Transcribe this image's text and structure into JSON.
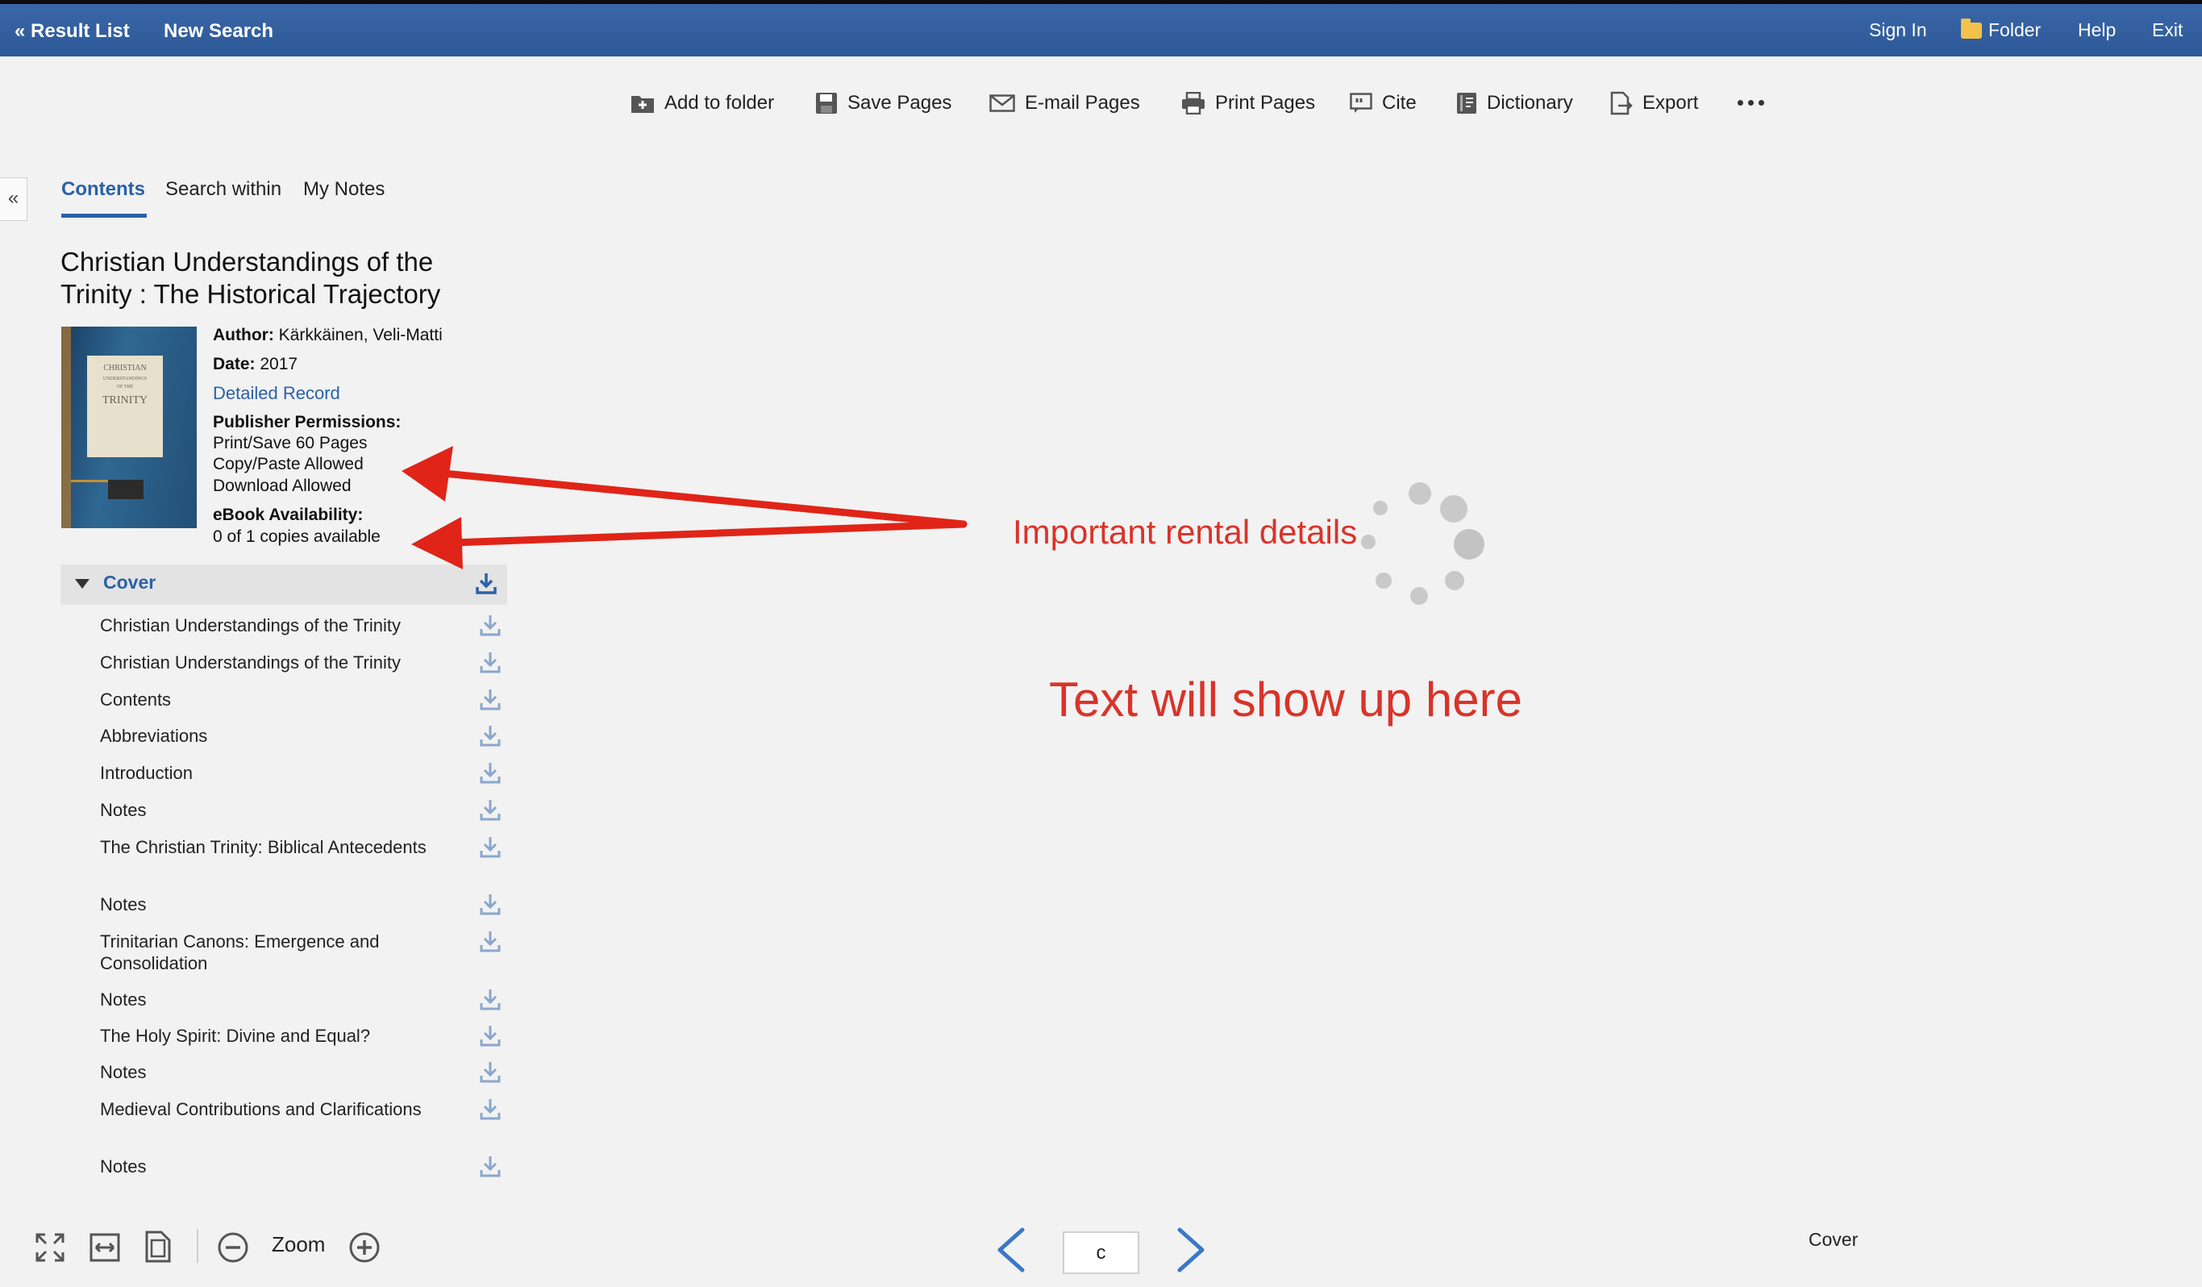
{
  "topbar": {
    "result_list": "« Result List",
    "new_search": "New Search",
    "sign_in": "Sign In",
    "folder": "Folder",
    "help": "Help",
    "exit": "Exit"
  },
  "toolbar": {
    "add_to_folder": "Add to folder",
    "save_pages": "Save Pages",
    "email_pages": "E-mail Pages",
    "print_pages": "Print Pages",
    "cite": "Cite",
    "dictionary": "Dictionary",
    "export": "Export"
  },
  "sidebar": {
    "collapse": "«",
    "tabs": [
      "Contents",
      "Search within",
      "My Notes"
    ]
  },
  "book": {
    "title": "Christian Understandings of the Trinity : The Historical Trajectory",
    "cover_text": [
      "CHRISTIAN",
      "UNDERSTANDINGS",
      "OF THE",
      "TRINITY"
    ],
    "author_label": "Author:",
    "author": "Kärkkäinen, Veli-Matti",
    "date_label": "Date:",
    "date": "2017",
    "detailed_record": "Detailed Record",
    "permissions_label": "Publisher Permissions:",
    "permissions": [
      "Print/Save 60 Pages",
      "Copy/Paste Allowed",
      "Download Allowed"
    ],
    "availability_label": "eBook Availability:",
    "availability": "0 of 1 copies available"
  },
  "toc": {
    "section": "Cover",
    "items": [
      "Christian Understandings of the Trinity",
      "Christian Understandings of the Trinity",
      "Contents",
      "Abbreviations",
      "Introduction",
      "Notes",
      "The Christian Trinity: Biblical Antecedents",
      "Notes",
      "Trinitarian Canons: Emergence and Consolidation",
      "Notes",
      "The Holy Spirit: Divine and Equal?",
      "Notes",
      "Medieval Contributions and Clarifications",
      "Notes"
    ]
  },
  "annotations": {
    "rental": "Important rental details",
    "text_placeholder": "Text will show up here",
    "arrow_color": "#e02418"
  },
  "bottom": {
    "zoom": "Zoom",
    "page_value": "c",
    "current_section": "Cover"
  },
  "colors": {
    "topbar": "#2d5897",
    "link": "#2a61a8",
    "annotation": "#d8342a"
  }
}
